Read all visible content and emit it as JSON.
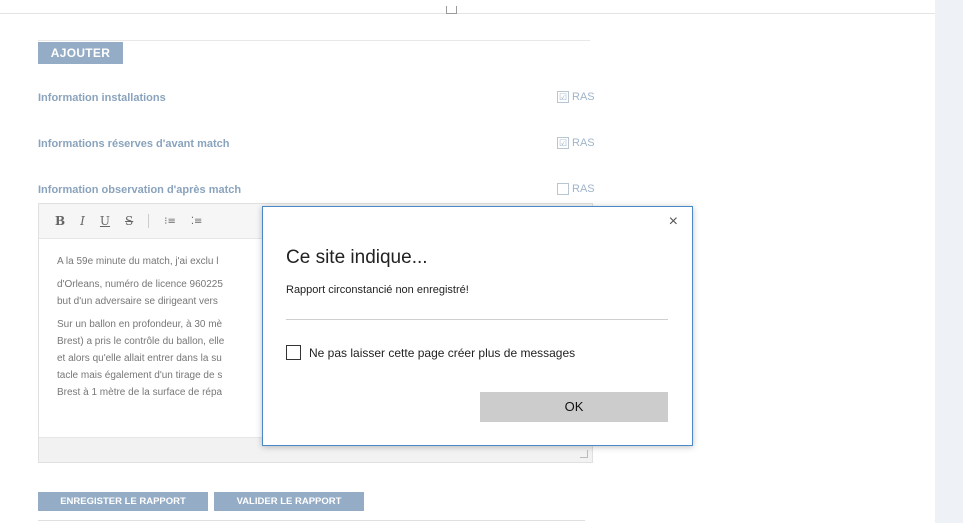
{
  "page": {
    "add_button": "AJOUTER",
    "rows": [
      {
        "label": "Information installations",
        "ras_label": "RAS",
        "checked_mark": "☑"
      },
      {
        "label": "Informations réserves d'avant match",
        "ras_label": "RAS",
        "checked_mark": "☑"
      },
      {
        "label": "Information observation d'après match",
        "ras_label": "RAS",
        "checked_mark": ""
      }
    ],
    "editor": {
      "toolbar": {
        "bold": "B",
        "italic": "I",
        "underline": "U",
        "strike": "S",
        "ol": "⁝≡",
        "ul": "⁚≡"
      },
      "lines": [
        "A la 59e minute du match, j'ai exclu l",
        "d'Orleans, numéro de licence 960225",
        "but d'un adversaire se dirigeant vers",
        "Sur un ballon en profondeur, à 30 mè",
        "Brest) a pris le contrôle du ballon, elle",
        "et alors qu'elle allait entrer dans la su",
        "tacle mais également d'un tirage de s",
        "Brest à 1 mètre de la surface de répa"
      ]
    },
    "save_button": "ENREGISTER LE RAPPORT",
    "validate_button": "VALIDER LE RAPPORT"
  },
  "dialog": {
    "close_glyph": "×",
    "title": "Ce site indique...",
    "message": "Rapport circonstancié non enregistré!",
    "checkbox_label": "Ne pas laisser cette page créer plus de messages",
    "ok_label": "OK"
  }
}
